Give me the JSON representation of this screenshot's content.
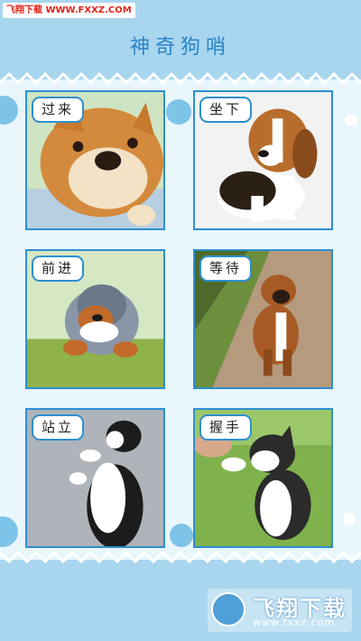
{
  "watermark": {
    "top_text": "飞翔下载 WWW.FXXZ.COM",
    "brand": "飞翔下载",
    "site": "www.fxxz.com"
  },
  "header": {
    "title": "神奇狗哨"
  },
  "commands": [
    {
      "label": "过来",
      "photo": "shiba-inu-face"
    },
    {
      "label": "坐下",
      "photo": "beagle-puppy-sitting"
    },
    {
      "label": "前进",
      "photo": "australian-shepherd-running"
    },
    {
      "label": "等待",
      "photo": "boxer-puppy-sitting-on-path"
    },
    {
      "label": "站立",
      "photo": "border-collie-standing"
    },
    {
      "label": "握手",
      "photo": "husky-puppy-shaking-hands"
    }
  ],
  "colors": {
    "accent": "#2d8fd0",
    "background": "#a9d6ef",
    "panel": "#e9f6fc"
  }
}
